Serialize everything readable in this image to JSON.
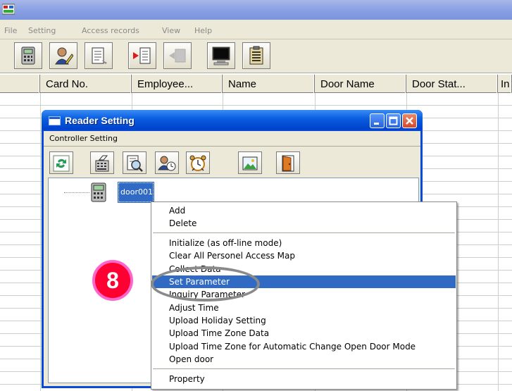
{
  "menubar": {
    "items": [
      "File",
      "Setting",
      "Access records",
      "View",
      "Help"
    ]
  },
  "toolbar": {
    "icons": [
      "controller-icon",
      "user-edit-icon",
      "document-icon",
      "record-arrow-icon",
      "door-disabled-icon",
      "monitor-icon",
      "clipboard-icon"
    ]
  },
  "grid": {
    "columns": [
      "",
      "Card No.",
      "Employee...",
      "Name",
      "Door Name",
      "Door Stat...",
      "In"
    ]
  },
  "dialog": {
    "title": "Reader Setting",
    "menu": "Controller Setting",
    "tree_item": "door001"
  },
  "context_menu": {
    "items": [
      "Add",
      "Delete",
      "Initialize (as off-line mode)",
      "Clear All Personel Access Map",
      "Collect Data",
      "Set Parameter",
      "Inquiry Parameter",
      "Adjust Time",
      "Upload Holiday Setting",
      "Upload Time Zone Data",
      "Upload Time Zone for  Automatic Change Open Door Mode",
      "Open door",
      "Property"
    ],
    "selected": "Set Parameter"
  },
  "annotation": {
    "step": "8"
  },
  "colors": {
    "title_bar": "#0a5fe0",
    "selection": "#316ac5",
    "step_badge": "#ff0033",
    "step_badge_border": "#ff66cc"
  }
}
